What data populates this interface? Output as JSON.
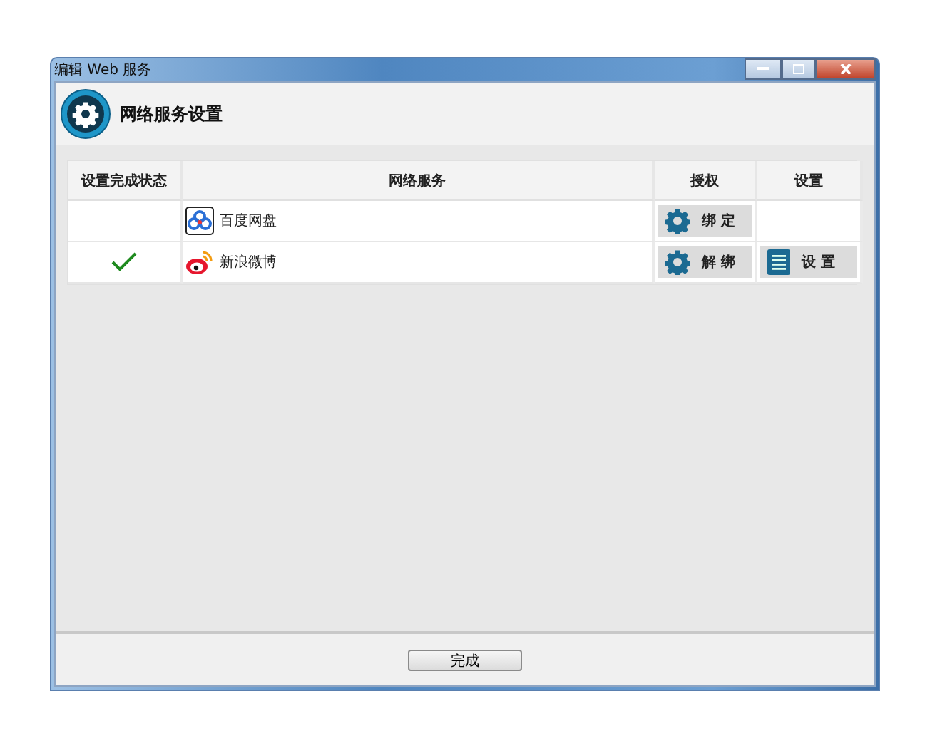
{
  "window": {
    "title": "编辑 Web 服务"
  },
  "header": {
    "title": "网络服务设置"
  },
  "table": {
    "columns": [
      "设置完成状态",
      "网络服务",
      "授权",
      "设置"
    ],
    "rows": [
      {
        "done": false,
        "service": {
          "kind": "baidu",
          "name": "百度网盘"
        },
        "auth": "绑 定"
      },
      {
        "done": true,
        "service": {
          "kind": "weibo",
          "name": "新浪微博"
        },
        "auth": "解 绑",
        "settings": "设 置"
      }
    ]
  },
  "footer": {
    "button": "完成"
  }
}
